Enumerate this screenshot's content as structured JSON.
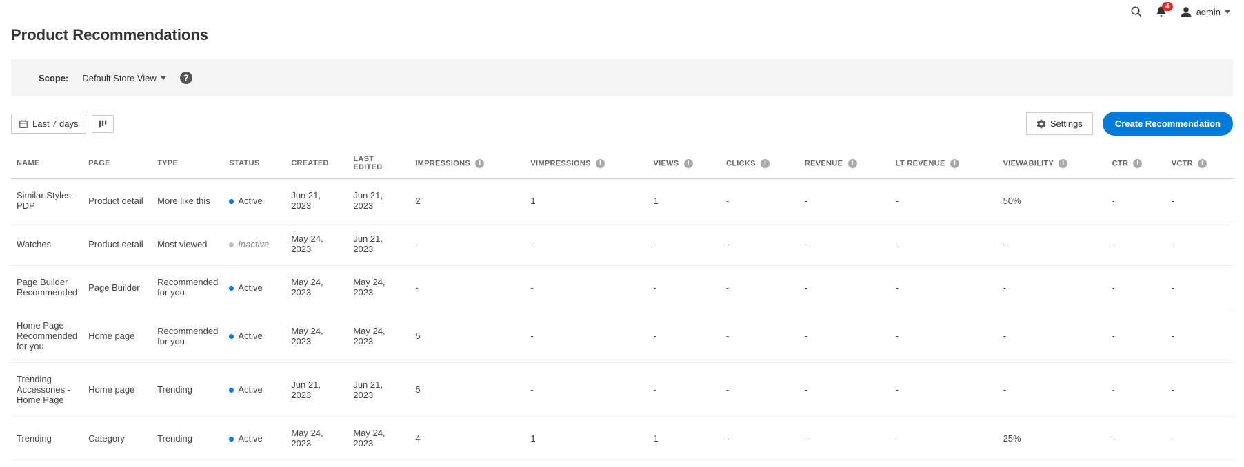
{
  "header": {
    "notif_count": "4",
    "user": "admin"
  },
  "page_title": "Product Recommendations",
  "scope": {
    "label": "Scope:",
    "value": "Default Store View"
  },
  "toolbar": {
    "date_range": "Last 7 days",
    "settings": "Settings",
    "create": "Create Recommendation"
  },
  "columns": {
    "name": "NAME",
    "page": "PAGE",
    "type": "TYPE",
    "status": "STATUS",
    "created": "CREATED",
    "last_edited": "LAST EDITED",
    "impressions": "IMPRESSIONS",
    "vimpressions": "vIMPRESSIONS",
    "views": "VIEWS",
    "clicks": "CLICKS",
    "revenue": "REVENUE",
    "lt_revenue": "LT REVENUE",
    "viewability": "VIEWABILITY",
    "ctr": "CTR",
    "vctr": "vCTR"
  },
  "rows": [
    {
      "name": "Similar Styles - PDP",
      "page": "Product detail",
      "type": "More like this",
      "status": "Active",
      "created": "Jun 21, 2023",
      "last_edited": "Jun 21, 2023",
      "impressions": "2",
      "vimpressions": "1",
      "views": "1",
      "clicks": "-",
      "revenue": "-",
      "lt_revenue": "-",
      "viewability": "50%",
      "ctr": "-",
      "vctr": "-"
    },
    {
      "name": "Watches",
      "page": "Product detail",
      "type": "Most viewed",
      "status": "Inactive",
      "created": "May 24, 2023",
      "last_edited": "Jun 21, 2023",
      "impressions": "-",
      "vimpressions": "-",
      "views": "-",
      "clicks": "-",
      "revenue": "-",
      "lt_revenue": "-",
      "viewability": "-",
      "ctr": "-",
      "vctr": "-"
    },
    {
      "name": "Page Builder Recommended",
      "page": "Page Builder",
      "type": "Recommended for you",
      "status": "Active",
      "created": "May 24, 2023",
      "last_edited": "May 24, 2023",
      "impressions": "-",
      "vimpressions": "-",
      "views": "-",
      "clicks": "-",
      "revenue": "-",
      "lt_revenue": "-",
      "viewability": "-",
      "ctr": "-",
      "vctr": "-"
    },
    {
      "name": "Home Page - Recommended for you",
      "page": "Home page",
      "type": "Recommended for you",
      "status": "Active",
      "created": "May 24, 2023",
      "last_edited": "May 24, 2023",
      "impressions": "5",
      "vimpressions": "-",
      "views": "-",
      "clicks": "-",
      "revenue": "-",
      "lt_revenue": "-",
      "viewability": "-",
      "ctr": "-",
      "vctr": "-"
    },
    {
      "name": "Trending Accessories - Home Page",
      "page": "Home page",
      "type": "Trending",
      "status": "Active",
      "created": "Jun 21, 2023",
      "last_edited": "Jun 21, 2023",
      "impressions": "5",
      "vimpressions": "-",
      "views": "-",
      "clicks": "-",
      "revenue": "-",
      "lt_revenue": "-",
      "viewability": "-",
      "ctr": "-",
      "vctr": "-"
    },
    {
      "name": "Trending",
      "page": "Category",
      "type": "Trending",
      "status": "Active",
      "created": "May 24, 2023",
      "last_edited": "May 24, 2023",
      "impressions": "4",
      "vimpressions": "1",
      "views": "1",
      "clicks": "-",
      "revenue": "-",
      "lt_revenue": "-",
      "viewability": "25%",
      "ctr": "-",
      "vctr": "-"
    }
  ]
}
